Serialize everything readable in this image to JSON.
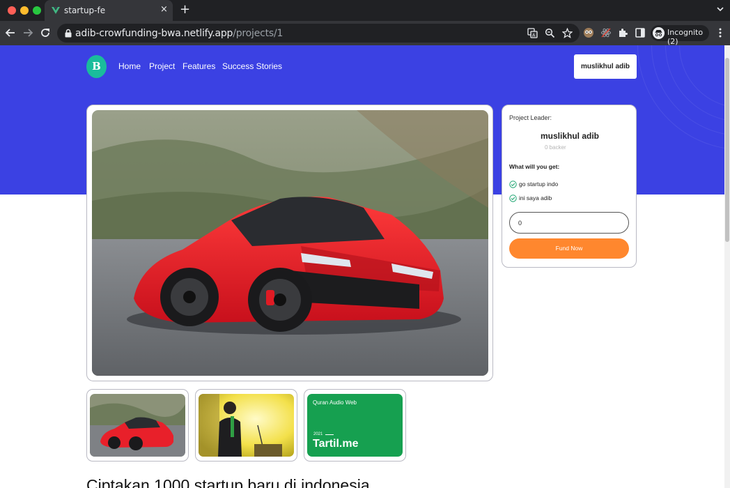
{
  "browser": {
    "tab_title": "startup-fe",
    "tab_close": "×",
    "new_tab": "+",
    "url_host": "adib-crowfunding-bwa.netlify.app",
    "url_path": "/projects/1",
    "profile_label": "Incognito (2)",
    "icons": [
      "back-icon",
      "forward-icon",
      "reload-icon",
      "lock-icon",
      "translate-icon",
      "zoom-icon",
      "star-icon",
      "extension-icon",
      "puzzle-icon",
      "sidepanel-icon",
      "incognito-icon",
      "menu-icon"
    ]
  },
  "navbar": {
    "logo_letter": "B",
    "links": [
      "Home",
      "Project",
      "Features",
      "Success Stories"
    ],
    "user_name": "muslikhul adib"
  },
  "project": {
    "leader_label": "Project Leader:",
    "leader_name": "muslikhul adib",
    "backers": "0 backer",
    "perks_title": "What will you get:",
    "perks": [
      "go startup indo",
      "ini saya adib"
    ],
    "amount_value": "0",
    "fund_button": "Fund Now"
  },
  "gallery": {
    "third_card_title": "Quran Audio Web",
    "third_card_year": "2021",
    "third_card_name": "Tartil.me"
  },
  "page_heading": "Ciptakan 1000 startup baru di indonesia",
  "colors": {
    "hero_blue": "#3b41e3",
    "logo_teal": "#1abc9c",
    "fund_orange": "#ff872e",
    "tartil_green": "#16a050",
    "car_red": "#e8202a"
  }
}
